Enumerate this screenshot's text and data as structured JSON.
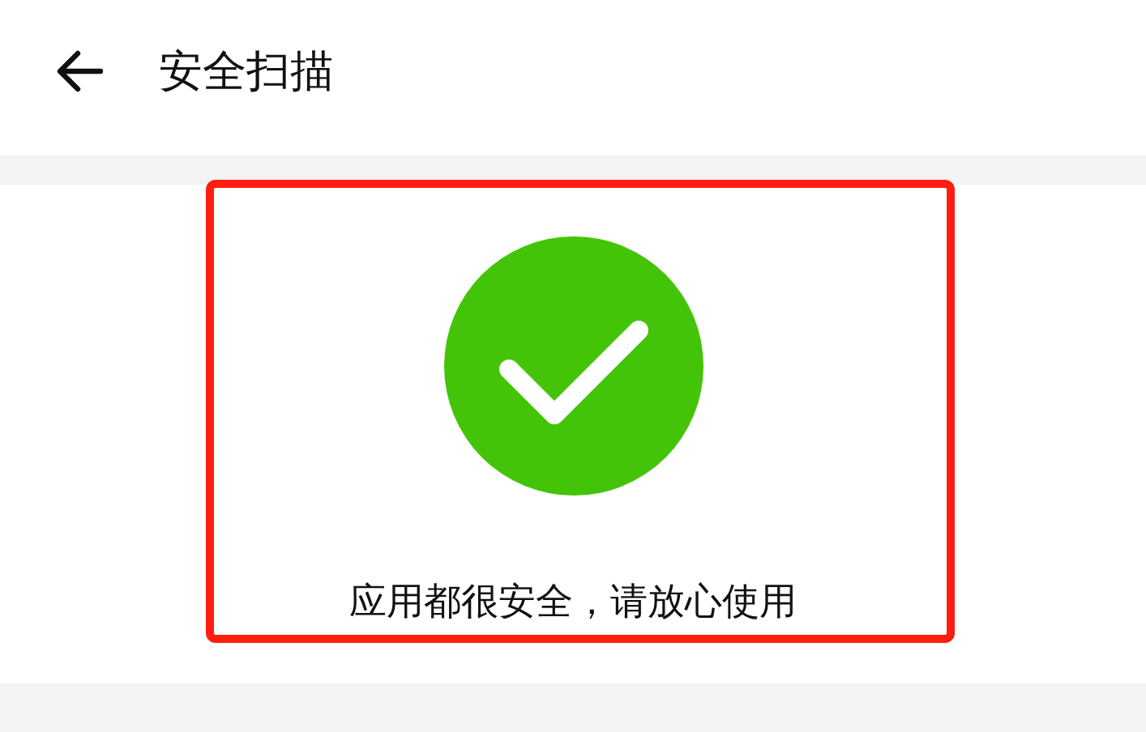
{
  "header": {
    "title": "安全扫描"
  },
  "result": {
    "kind": "success",
    "message": "应用都很安全，请放心使用"
  }
}
